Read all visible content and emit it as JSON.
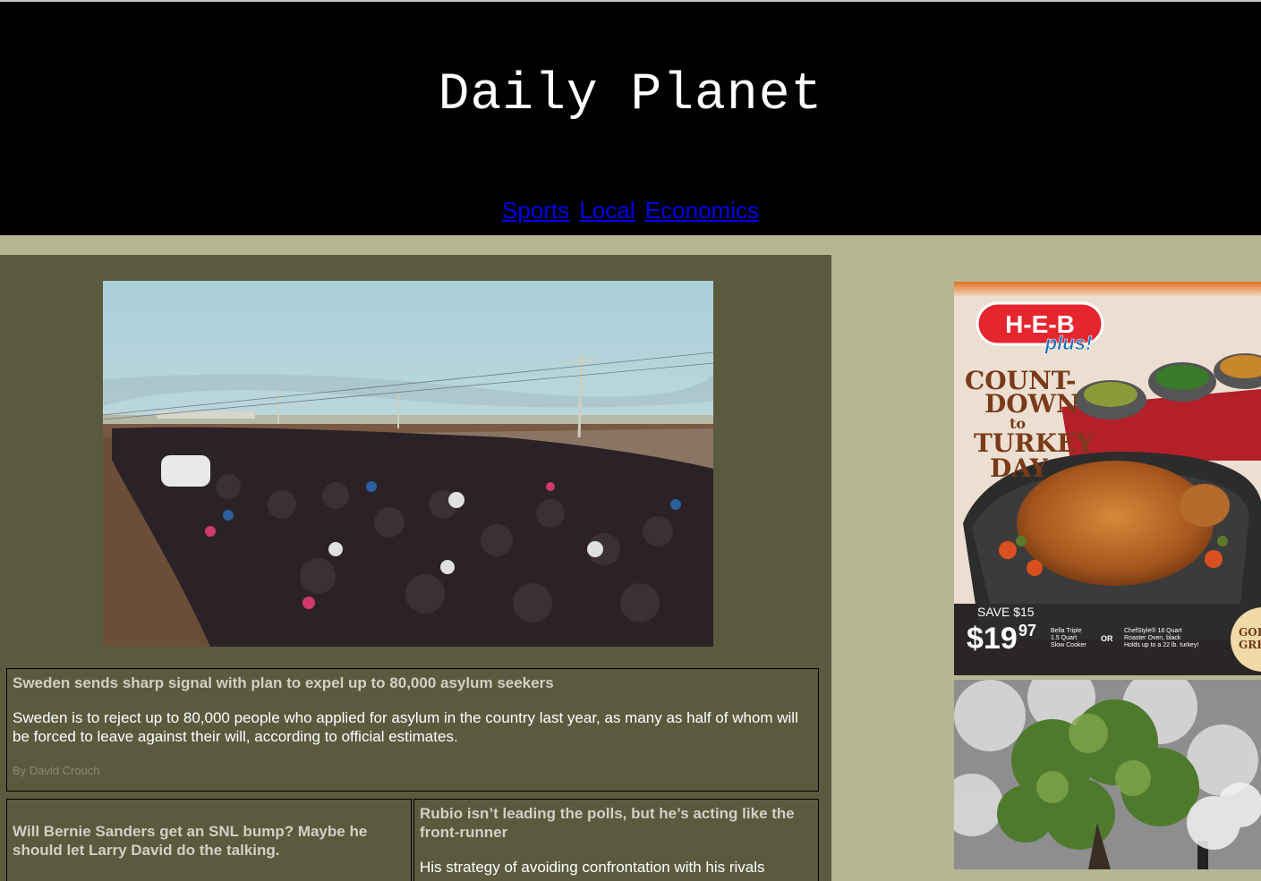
{
  "site": {
    "title": "Daily Planet"
  },
  "nav": {
    "items": [
      "Sports",
      "Local",
      "Economics"
    ]
  },
  "lead_article": {
    "headline": "Sweden sends sharp signal with plan to expel up to 80,000 asylum seekers",
    "summary": "Sweden is to reject up to 80,000 people who applied for asylum in the country last year, as many as half of whom will be forced to leave against their will, according to official estimates.",
    "byline": "By David Crouch"
  },
  "articles": [
    {
      "headline": "Will Bernie Sanders get an SNL bump? Maybe he should let Larry David do the talking."
    },
    {
      "headline": "Rubio isn’t leading the polls, but he’s acting like the front-runner",
      "summary": "His strategy of avoiding confrontation with his rivals"
    }
  ],
  "ad": {
    "brand": "H-E-B",
    "brand_sub": "plus!",
    "tagline_lines": [
      "COUNT-",
      "DOWN",
      "to",
      "TURKEY",
      "DAY"
    ],
    "save": "SAVE $15",
    "price_dollar": "$19",
    "price_cents": "97",
    "product1": [
      "Bella Triple",
      "1.5 Quart",
      "Slow Cooker"
    ],
    "or": "OR",
    "product2": [
      "ChefStyle® 18 Quart",
      "Roaster Oven, black",
      "Holds up to a 22 lb. turkey!"
    ],
    "corner": [
      "GOB",
      "GRE"
    ]
  },
  "colors": {
    "page_bg": "#b6b693",
    "header_bg": "#000000",
    "main_bg": "#5a5a3e",
    "link": "#0000ee",
    "headline": "#d0d0c4"
  }
}
